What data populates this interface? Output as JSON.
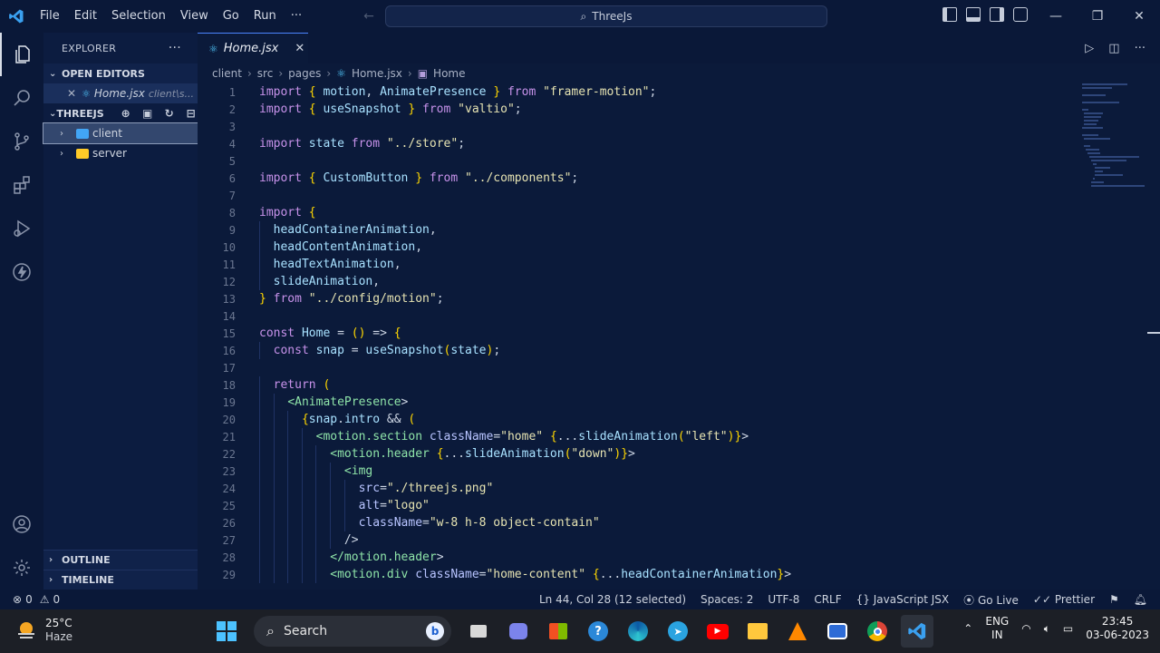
{
  "titlebar": {
    "menu": [
      "File",
      "Edit",
      "Selection",
      "View",
      "Go",
      "Run"
    ],
    "more": "···",
    "search_text": "ThreeJs",
    "win_min": "—",
    "win_restore": "❐",
    "win_close": "✕"
  },
  "sidebar": {
    "title": "EXPLORER",
    "more": "···",
    "open_editors_label": "OPEN EDITORS",
    "open_editor": {
      "name": "Home.jsx",
      "path": "client\\s..."
    },
    "project_label": "THREEJS",
    "tree": [
      {
        "name": "client",
        "selected": true
      },
      {
        "name": "server",
        "selected": false
      }
    ],
    "outline_label": "OUTLINE",
    "timeline_label": "TIMELINE"
  },
  "tab": {
    "name": "Home.jsx",
    "close": "✕"
  },
  "breadcrumb": [
    "client",
    "src",
    "pages",
    "Home.jsx",
    "Home"
  ],
  "code_lines": [
    "import { motion, AnimatePresence } from \"framer-motion\";",
    "import { useSnapshot } from \"valtio\";",
    "",
    "import state from \"../store\";",
    "",
    "import { CustomButton } from \"../components\";",
    "",
    "import {",
    "  headContainerAnimation,",
    "  headContentAnimation,",
    "  headTextAnimation,",
    "  slideAnimation,",
    "} from \"../config/motion\";",
    "",
    "const Home = () => {",
    "  const snap = useSnapshot(state);",
    "",
    "  return (",
    "    <AnimatePresence>",
    "      {snap.intro && (",
    "        <motion.section className=\"home\" {...slideAnimation(\"left\")}>",
    "          <motion.header {...slideAnimation(\"down\")}>",
    "            <img",
    "              src=\"./threejs.png\"",
    "              alt=\"logo\"",
    "              className=\"w-8 h-8 object-contain\"",
    "            />",
    "          </motion.header>",
    "          <motion.div className=\"home-content\" {...headContainerAnimation}>"
  ],
  "statusbar": {
    "errors": "0",
    "warnings": "0",
    "position": "Ln 44, Col 28 (12 selected)",
    "spaces": "Spaces: 2",
    "encoding": "UTF-8",
    "eol": "CRLF",
    "language": "JavaScript JSX",
    "golive": "Go Live",
    "prettier": "Prettier"
  },
  "taskbar": {
    "temp": "25°C",
    "condition": "Haze",
    "search": "Search",
    "lang1": "ENG",
    "lang2": "IN",
    "time": "23:45",
    "date": "03-06-2023"
  },
  "colors": {
    "accent": "#4b84ff",
    "editor_bg": "#0b1a3a",
    "sidebar_bg": "#0c1c40"
  }
}
